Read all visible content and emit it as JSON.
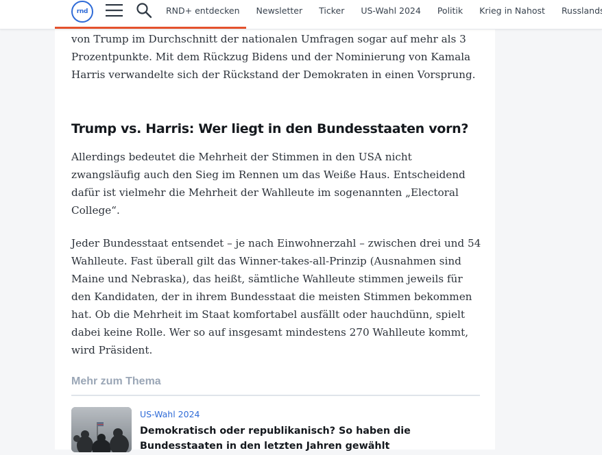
{
  "header": {
    "logo_text": "rnd",
    "nav": [
      "RND+ entdecken",
      "Newsletter",
      "Ticker",
      "US-Wahl 2024",
      "Politik",
      "Krieg in Nahost",
      "Russlands Krieg"
    ],
    "accent_color": "#e4522d",
    "brand_color": "#2f6bd7"
  },
  "reading_progress": 0.35,
  "article": {
    "paragraph_1": "von Trump im Durchschnitt der nationalen Umfragen sogar auf mehr als 3 Prozentpunkte. Mit dem Rückzug Bidens und der Nominierung von Kamala Harris verwandelte sich der Rückstand der Demokraten in einen Vorsprung.",
    "heading": "Trump vs. Harris: Wer liegt in den Bundesstaaten vorn?",
    "paragraph_2": "Allerdings bedeutet die Mehrheit der Stimmen in den USA nicht zwangsläufig auch den Sieg im Rennen um das Weiße Haus. Entscheidend dafür ist vielmehr die Mehrheit der Wahlleute im sogenannten „Electoral College“.",
    "paragraph_3": "Jeder Bundesstaat entsendet – je nach Einwohnerzahl – zwischen drei und 54 Wahlleute. Fast überall gilt das Winner-takes-all-Prinzip (Ausnahmen sind Maine und Nebraska), das heißt, sämtliche Wahlleute stimmen jeweils für den Kandidaten, der in ihrem Bundesstaat die meisten Stimmen bekommen hat. Ob die Mehrheit im Staat komfortabel ausfällt oder hauchdünn, spielt dabei keine Rolle. Wer so auf insgesamt mindestens 270 Wahlleute kommt, wird Präsident."
  },
  "more": {
    "label": "Mehr zum Thema",
    "teaser": {
      "kicker": "US-Wahl 2024",
      "title": "Demokratisch oder republikanisch? So haben die Bundesstaaten in den letzten Jahren gewählt"
    }
  }
}
